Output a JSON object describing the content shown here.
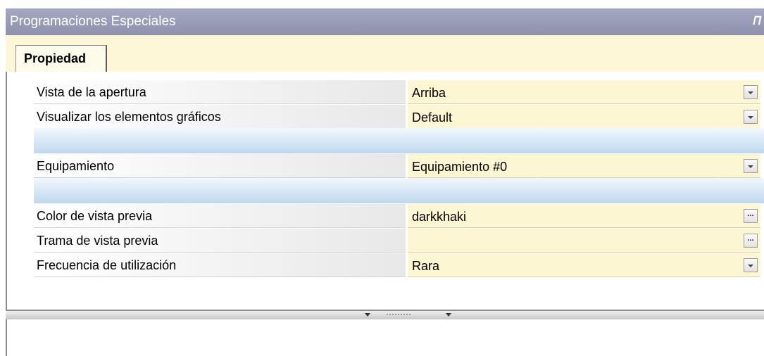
{
  "window": {
    "title": "Programaciones Especiales",
    "pin_icon": "pin-icon"
  },
  "tabs": [
    {
      "label": "Propiedad"
    }
  ],
  "properties": [
    {
      "label": "Vista de la apertura",
      "value": "Arriba",
      "editor": "dropdown"
    },
    {
      "label": "Visualizar los elementos gráficos",
      "value": "Default",
      "editor": "dropdown"
    },
    {
      "label": "Equipamiento",
      "value": "Equipamiento #0",
      "editor": "dropdown"
    },
    {
      "label": "Color de vista previa",
      "value": "darkkhaki",
      "editor": "ellipsis"
    },
    {
      "label": "Trama de vista previa",
      "value": "",
      "editor": "ellipsis"
    },
    {
      "label": "Frecuencia de utilización",
      "value": "Rara",
      "editor": "dropdown"
    }
  ],
  "editor_glyphs": {
    "ellipsis": "...",
    "dropdown": "chevron-down-icon"
  },
  "splitter": {
    "dots": "·········"
  },
  "colors": {
    "titlebar": "#9a9cb8",
    "tabstrip": "#fdf6d7",
    "value_cell": "#fdf6d2",
    "category_separator": "#c9dcef"
  }
}
